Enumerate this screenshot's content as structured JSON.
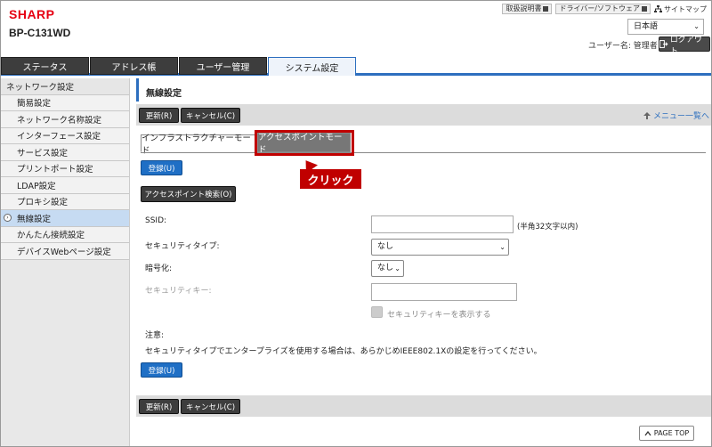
{
  "header": {
    "brand": "SHARP",
    "model": "BP-C131WD",
    "links": [
      "取扱説明書",
      "ドライバー/ソフトウェア"
    ],
    "sitemap": "サイトマップ",
    "language": "日本語",
    "user_label": "ユーザー名: 管理者",
    "logout": "ログアウト"
  },
  "tabs": [
    "ステータス",
    "アドレス帳",
    "ユーザー管理",
    "システム設定"
  ],
  "sidebar": {
    "items": [
      "ネットワーク設定",
      "簡易設定",
      "ネットワーク名称設定",
      "インターフェース設定",
      "サービス設定",
      "プリントポート設定",
      "LDAP設定",
      "プロキシ設定",
      "無線設定",
      "かんたん接続設定",
      "デバイスWebページ設定"
    ]
  },
  "main": {
    "title": "無線設定",
    "update": "更新(R)",
    "cancel": "キャンセル(C)",
    "menu_link": "メニュー一覧へ",
    "subtabs": [
      "インフラストラクチャーモード",
      "アクセスポイントモード"
    ],
    "callout": "クリック",
    "register": "登録(U)",
    "ap_search": "アクセスポイント検索(O)",
    "ssid_label": "SSID:",
    "ssid_hint": "(半角32文字以内)",
    "security_type_label": "セキュリティタイプ:",
    "security_type_value": "なし",
    "encryption_label": "暗号化:",
    "encryption_value": "なし",
    "security_key_label": "セキュリティキー:",
    "show_key_label": "セキュリティキーを表示する",
    "note_title": "注意:",
    "note_text": "セキュリティタイプでエンタープライズを使用する場合は、あらかじめIEEE802.1Xの設定を行ってください。",
    "page_top": "PAGE TOP"
  }
}
